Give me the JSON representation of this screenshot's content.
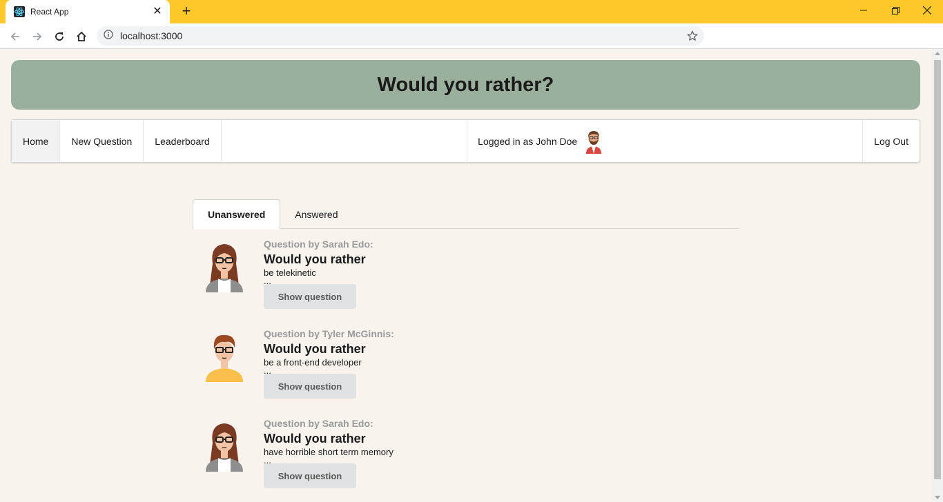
{
  "browser": {
    "tab_title": "React App",
    "url": "localhost:3000"
  },
  "app": {
    "title": "Would you rather?"
  },
  "nav": {
    "items": [
      {
        "label": "Home"
      },
      {
        "label": "New Question"
      },
      {
        "label": "Leaderboard"
      }
    ],
    "logged_in_text": "Logged in as John Doe",
    "logout_label": "Log Out"
  },
  "tabs": {
    "unanswered": "Unanswered",
    "answered": "Answered"
  },
  "questions": [
    {
      "author": "Question by Sarah Edo:",
      "heading": "Would you rather",
      "option": "be telekinetic",
      "ellipsis": "...",
      "button": "Show question"
    },
    {
      "author": "Question by Tyler McGinnis:",
      "heading": "Would you rather",
      "option": "be a front-end developer",
      "ellipsis": "...",
      "button": "Show question"
    },
    {
      "author": "Question by Sarah Edo:",
      "heading": "Would you rather",
      "option": "have horrible short term memory",
      "ellipsis": "...",
      "button": "Show question"
    }
  ],
  "colors": {
    "browser_frame": "#fec82a",
    "hero_bg": "#9bb09c",
    "page_bg": "#f8f3ed"
  }
}
